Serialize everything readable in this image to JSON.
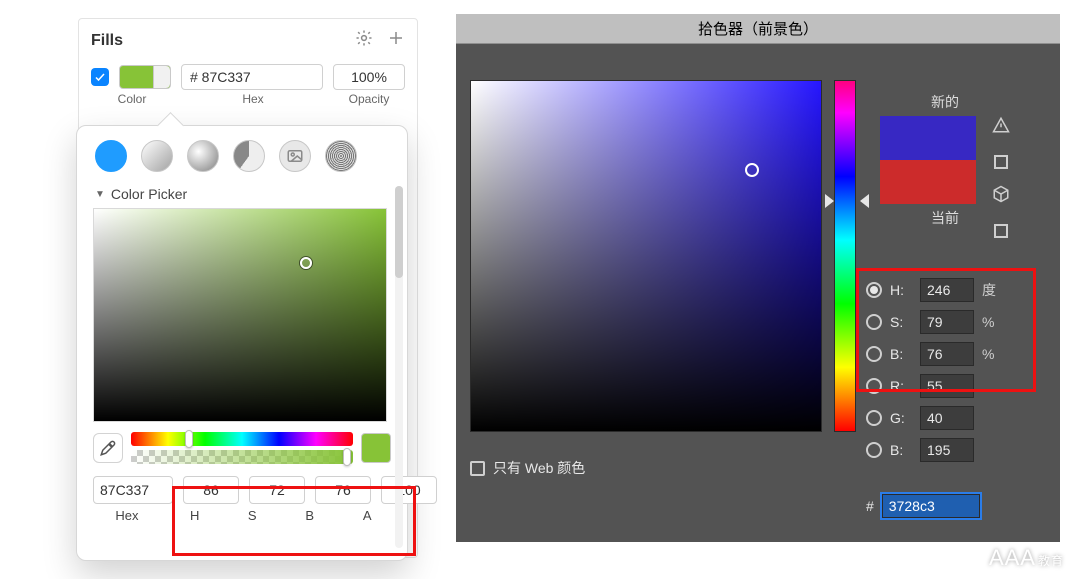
{
  "left": {
    "title": "Fills",
    "checkbox_enabled": true,
    "swatch_color": "#87C337",
    "hex_value": "# 87C337",
    "opacity_value": "100%",
    "labels": {
      "color": "Color",
      "hex": "Hex",
      "opacity": "Opacity"
    },
    "popover": {
      "section_label": "Color Picker",
      "hex": "87C337",
      "H": "86",
      "S": "72",
      "B": "76",
      "A": "100",
      "col_labels": {
        "hex": "Hex",
        "H": "H",
        "S": "S",
        "B": "B",
        "A": "A"
      }
    }
  },
  "right": {
    "title": "拾色器（前景色）",
    "new_label": "新的",
    "current_label": "当前",
    "web_only_label": "只有 Web 颜色",
    "params": {
      "H": {
        "label": "H:",
        "value": "246",
        "unit": "度",
        "selected": true
      },
      "S": {
        "label": "S:",
        "value": "79",
        "unit": "%",
        "selected": false
      },
      "Bv": {
        "label": "B:",
        "value": "76",
        "unit": "%",
        "selected": false
      },
      "R": {
        "label": "R:",
        "value": "55",
        "unit": "",
        "selected": false
      },
      "G": {
        "label": "G:",
        "value": "40",
        "unit": "",
        "selected": false
      },
      "Bc": {
        "label": "B:",
        "value": "195",
        "unit": "",
        "selected": false
      }
    },
    "hex_prefix": "#",
    "hex_value": "3728c3"
  },
  "watermark": {
    "big": "AAA",
    "small": "教育"
  }
}
